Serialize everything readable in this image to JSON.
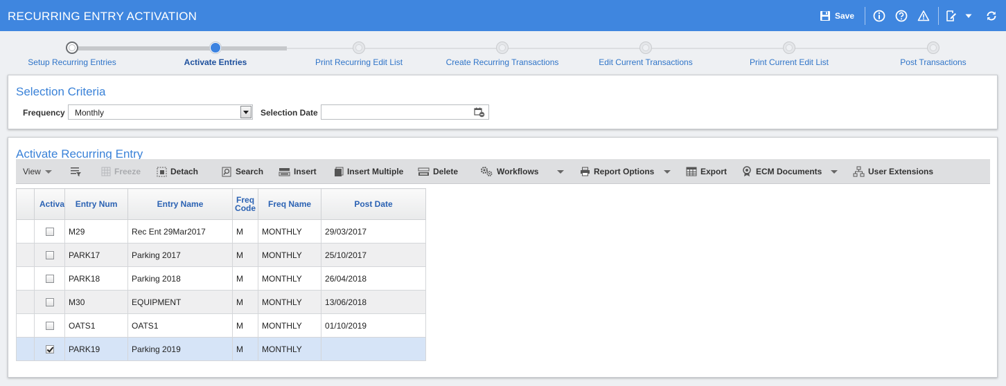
{
  "header": {
    "title": "RECURRING ENTRY ACTIVATION",
    "save_label": "Save"
  },
  "wizard": {
    "steps": [
      {
        "label": "Setup Recurring Entries",
        "state": "visited"
      },
      {
        "label": "Activate Entries",
        "state": "active"
      },
      {
        "label": "Print Recurring Edit List",
        "state": "pending"
      },
      {
        "label": "Create Recurring Transactions",
        "state": "pending"
      },
      {
        "label": "Edit Current Transactions",
        "state": "pending"
      },
      {
        "label": "Print Current Edit List",
        "state": "pending"
      },
      {
        "label": "Post Transactions",
        "state": "pending"
      }
    ]
  },
  "selection": {
    "title": "Selection Criteria",
    "frequency_label": "Frequency",
    "frequency_value": "Monthly",
    "date_label": "Selection Date",
    "date_value": ""
  },
  "activate": {
    "title": "Activate Recurring Entry",
    "toolbar": {
      "view": "View",
      "freeze": "Freeze",
      "detach": "Detach",
      "search": "Search",
      "insert": "Insert",
      "insert_multiple": "Insert Multiple",
      "delete": "Delete",
      "workflows": "Workflows",
      "report_options": "Report Options",
      "export": "Export",
      "ecm_documents": "ECM Documents",
      "user_extensions": "User Extensions"
    },
    "columns": [
      "Activa",
      "Entry Num",
      "Entry Name",
      "Freq Code",
      "Freq Name",
      "Post Date"
    ],
    "rows": [
      {
        "activate": false,
        "entry_num": "M29",
        "entry_name": "Rec Ent 29Mar2017",
        "freq_code": "M",
        "freq_name": "MONTHLY",
        "post_date": "29/03/2017"
      },
      {
        "activate": false,
        "entry_num": "PARK17",
        "entry_name": "Parking 2017",
        "freq_code": "M",
        "freq_name": "MONTHLY",
        "post_date": "25/10/2017"
      },
      {
        "activate": false,
        "entry_num": "PARK18",
        "entry_name": "Parking 2018",
        "freq_code": "M",
        "freq_name": "MONTHLY",
        "post_date": "26/04/2018"
      },
      {
        "activate": false,
        "entry_num": "M30",
        "entry_name": "EQUIPMENT",
        "freq_code": "M",
        "freq_name": "MONTHLY",
        "post_date": "13/06/2018"
      },
      {
        "activate": false,
        "entry_num": "OATS1",
        "entry_name": "OATS1",
        "freq_code": "M",
        "freq_name": "MONTHLY",
        "post_date": "01/10/2019"
      },
      {
        "activate": true,
        "entry_num": "PARK19",
        "entry_name": "Parking 2019",
        "freq_code": "M",
        "freq_name": "MONTHLY",
        "post_date": ""
      }
    ]
  },
  "colors": {
    "titlebar": "#3f86df",
    "accent": "#3a82d8",
    "wizard_active": "#3b82e0",
    "selected_row": "#d6e4f7"
  }
}
